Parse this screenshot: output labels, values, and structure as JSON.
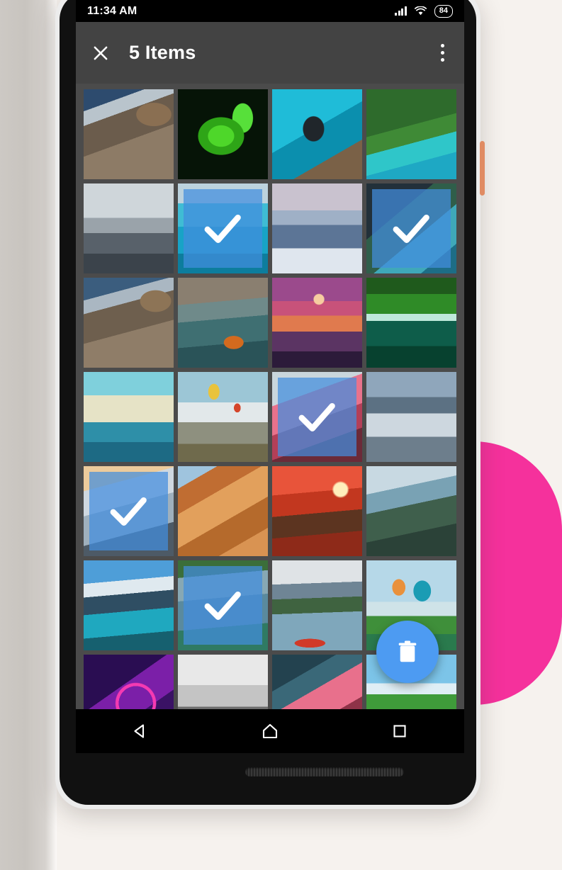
{
  "background": {
    "accent_pink": "#f5319c",
    "page_bg": "#f6f2ee"
  },
  "device": {
    "power_button_color": "#e08b63",
    "frame_color": "#ececec"
  },
  "status_bar": {
    "time": "11:34 AM",
    "battery_level": "84",
    "signal_icon": "signal-bars-icon",
    "wifi_icon": "wifi-icon",
    "battery_icon": "battery-icon"
  },
  "app_bar": {
    "close_icon": "close-icon",
    "title": "5 Items",
    "overflow_icon": "overflow-menu-icon"
  },
  "fab": {
    "icon": "delete-trash-icon",
    "color": "#4d9bf2",
    "label": "Delete"
  },
  "nav_bar": {
    "back_icon": "back-triangle-icon",
    "home_icon": "home-icon",
    "recents_icon": "recents-square-icon"
  },
  "selection": {
    "count": 5,
    "overlay_color": "#428ede",
    "check_icon": "checkmark-icon"
  },
  "grid": {
    "columns": 4,
    "rows": 7,
    "tiles": [
      {
        "id": 1,
        "art": "a-pier",
        "alt": "wooden pier over alpine lake",
        "selected": false
      },
      {
        "id": 2,
        "art": "a-fern",
        "alt": "green fern on dark background",
        "selected": false
      },
      {
        "id": 3,
        "art": "a-diver",
        "alt": "scuba diver in turquoise water",
        "selected": false
      },
      {
        "id": 4,
        "art": "a-coast",
        "alt": "green cliffs over tropical sea",
        "selected": false
      },
      {
        "id": 5,
        "art": "a-snowmtn",
        "alt": "snow covered mountain range",
        "selected": false
      },
      {
        "id": 6,
        "art": "a-turquoise",
        "alt": "turquoise lagoon island",
        "selected": true
      },
      {
        "id": 7,
        "art": "a-matterhorn",
        "alt": "matterhorn peak at dusk",
        "selected": false
      },
      {
        "id": 8,
        "art": "a-cliffsea",
        "alt": "rocky coastline and sea",
        "selected": true
      },
      {
        "id": 9,
        "art": "a-pier2",
        "alt": "wooden dock and boathouse",
        "selected": false
      },
      {
        "id": 10,
        "art": "a-boatlake",
        "alt": "person and red boat on lake",
        "selected": false
      },
      {
        "id": 11,
        "art": "a-fuji",
        "alt": "mount fuji sunset illustration",
        "selected": false
      },
      {
        "id": 12,
        "art": "a-waterfall",
        "alt": "waterfall in green gorge",
        "selected": false
      },
      {
        "id": 13,
        "art": "a-minimal",
        "alt": "minimal teal mountain silhouette",
        "selected": false
      },
      {
        "id": 14,
        "art": "a-balloons",
        "alt": "hot air balloons over clouds",
        "selected": false
      },
      {
        "id": 15,
        "art": "a-sakura",
        "alt": "pink blossom forest",
        "selected": true
      },
      {
        "id": 16,
        "art": "a-stonelake",
        "alt": "stones in mountain lake",
        "selected": false
      },
      {
        "id": 17,
        "art": "a-snowslope",
        "alt": "snowy slope at sunrise",
        "selected": true
      },
      {
        "id": 18,
        "art": "a-sandwave",
        "alt": "orange sandstone wave",
        "selected": false
      },
      {
        "id": 19,
        "art": "a-redsunset",
        "alt": "red sunset through pine trees",
        "selected": false
      },
      {
        "id": 20,
        "art": "a-fencepath",
        "alt": "mountain ridge fence path",
        "selected": false
      },
      {
        "id": 21,
        "art": "a-moraine",
        "alt": "moraine lake with pines",
        "selected": false
      },
      {
        "id": 22,
        "art": "a-fallswide",
        "alt": "wide waterfall cliff",
        "selected": true
      },
      {
        "id": 23,
        "art": "a-canoes",
        "alt": "canoes on mountain lake",
        "selected": false
      },
      {
        "id": 24,
        "art": "a-balloons2",
        "alt": "two hot air balloons over field",
        "selected": false
      },
      {
        "id": 25,
        "art": "a-neon",
        "alt": "purple neon ring abstract",
        "selected": false
      },
      {
        "id": 26,
        "art": "a-bwforest",
        "alt": "black and white foggy road",
        "selected": false
      },
      {
        "id": 27,
        "art": "a-cherry",
        "alt": "cherry blossom tree in forest",
        "selected": false
      },
      {
        "id": 28,
        "art": "a-greenlake",
        "alt": "green meadow lake landscape",
        "selected": false
      }
    ]
  }
}
